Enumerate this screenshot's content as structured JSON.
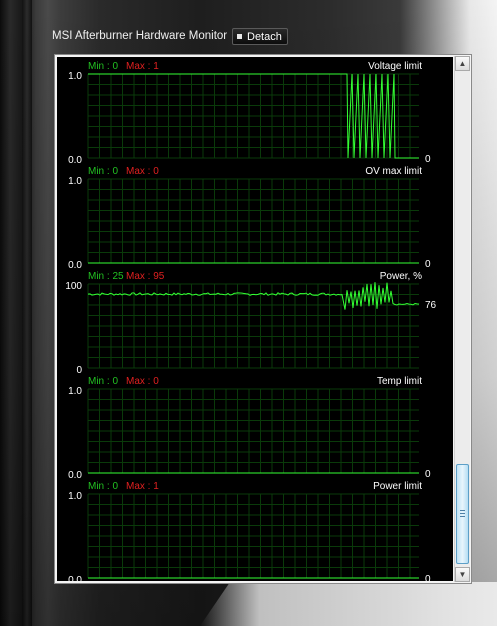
{
  "window": {
    "title": "MSI Afterburner Hardware Monitor",
    "detach_label": "Detach"
  },
  "colors": {
    "graph_line": "#33ff33",
    "grid": "#0a3a0a",
    "min_text": "#22c022",
    "max_text": "#e02020",
    "label_text": "#ffffff",
    "background": "#000000"
  },
  "graphs": [
    {
      "name": "Voltage limit",
      "min_label": "Min : 0",
      "max_label": "Max : 1",
      "y_top": "1.0",
      "y_bottom": "0.0",
      "current": "0"
    },
    {
      "name": "OV max limit",
      "min_label": "Min : 0",
      "max_label": "Max : 0",
      "y_top": "1.0",
      "y_bottom": "0.0",
      "current": "0"
    },
    {
      "name": "Power, %",
      "min_label": "Min : 25",
      "max_label": "Max : 95",
      "y_top": "100",
      "y_bottom": "0",
      "current": "76"
    },
    {
      "name": "Temp limit",
      "min_label": "Min : 0",
      "max_label": "Max : 0",
      "y_top": "1.0",
      "y_bottom": "0.0",
      "current": "0"
    },
    {
      "name": "Power limit",
      "min_label": "Min : 0",
      "max_label": "Max : 1",
      "y_top": "1.0",
      "y_bottom": "0.0",
      "current": "0"
    }
  ],
  "scrollbar": {
    "up_icon": "chevron-up-icon",
    "down_icon": "chevron-down-icon",
    "position": 0.85
  }
}
